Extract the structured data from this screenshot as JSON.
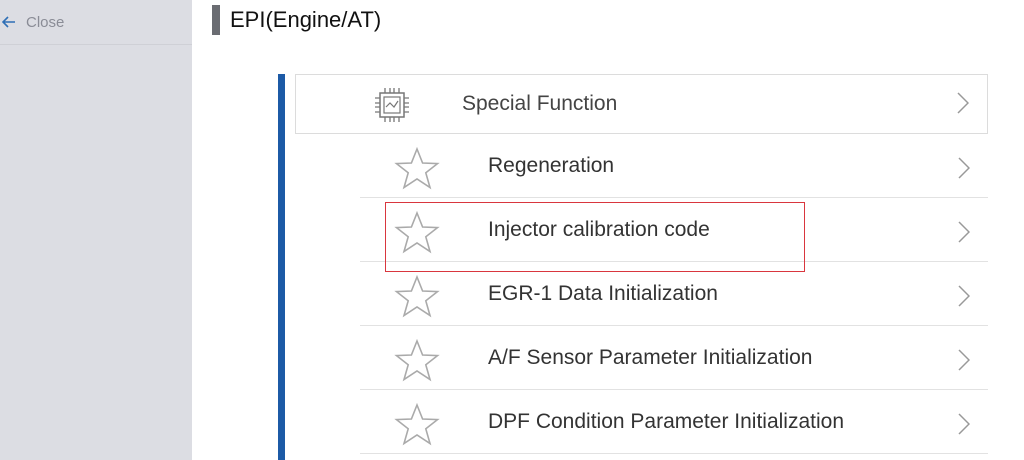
{
  "sidebar": {
    "close_label": "Close"
  },
  "header": {
    "title": "EPI(Engine/AT)"
  },
  "special_function": {
    "label": "Special Function"
  },
  "functions": [
    {
      "label": "Regeneration"
    },
    {
      "label": "Injector calibration code"
    },
    {
      "label": "EGR-1 Data Initialization"
    },
    {
      "label": "A/F Sensor Parameter Initialization"
    },
    {
      "label": "DPF Condition Parameter Initialization"
    }
  ],
  "colors": {
    "accent_bar": "#1c5aa6",
    "highlight": "#d9363e",
    "sidebar_bg": "#dcdde3"
  },
  "highlighted_item": "Injector calibration code"
}
